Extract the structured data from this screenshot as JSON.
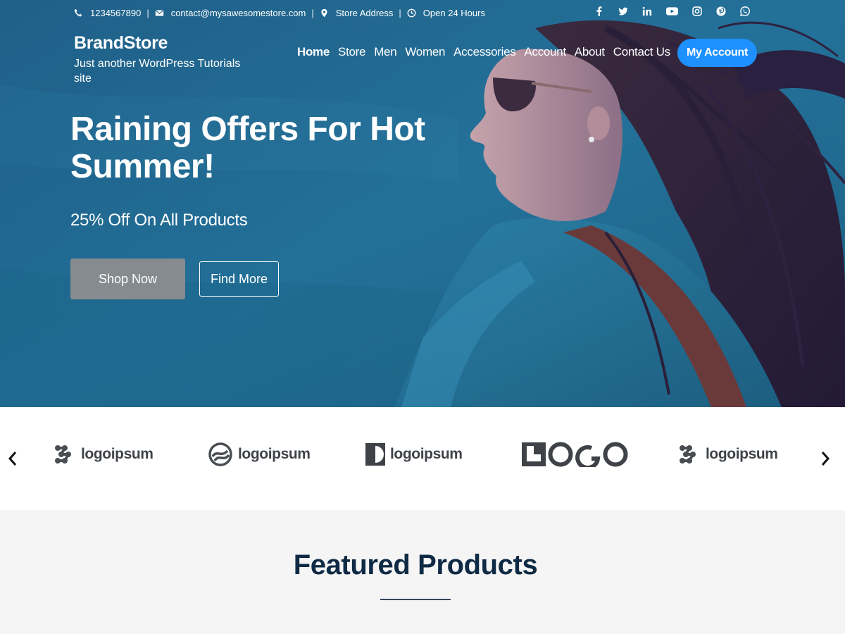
{
  "topbar": {
    "phone": "1234567890",
    "email": "contact@mysawesomestore.com",
    "address": "Store Address",
    "hours": "Open 24 Hours",
    "separator": "|",
    "socials": [
      "facebook-icon",
      "twitter-icon",
      "linkedin-icon",
      "youtube-icon",
      "instagram-icon",
      "pinterest-icon",
      "whatsapp-icon"
    ]
  },
  "brand": {
    "title": "BrandStore",
    "tagline": "Just another WordPress Tutorials site"
  },
  "nav": {
    "items": [
      "Home",
      "Store",
      "Men",
      "Women",
      "Accessories",
      "Account",
      "About",
      "Contact Us"
    ],
    "active": "Home",
    "account_button": "My Account"
  },
  "hero": {
    "title": "Raining Offers For Hot Summer!",
    "subtitle": "25% Off On All Products",
    "primary_button": "Shop Now",
    "secondary_button": "Find More"
  },
  "logos": {
    "items": [
      "logoipsum",
      "logoipsum",
      "logoipsum",
      "LOGO",
      "logoipsum"
    ]
  },
  "featured": {
    "title": "Featured Products"
  },
  "colors": {
    "hero_blue": "#1f6d92",
    "accent": "#1e90ff",
    "shop_button": "#868b8f",
    "featured_title": "#0f2a44"
  }
}
